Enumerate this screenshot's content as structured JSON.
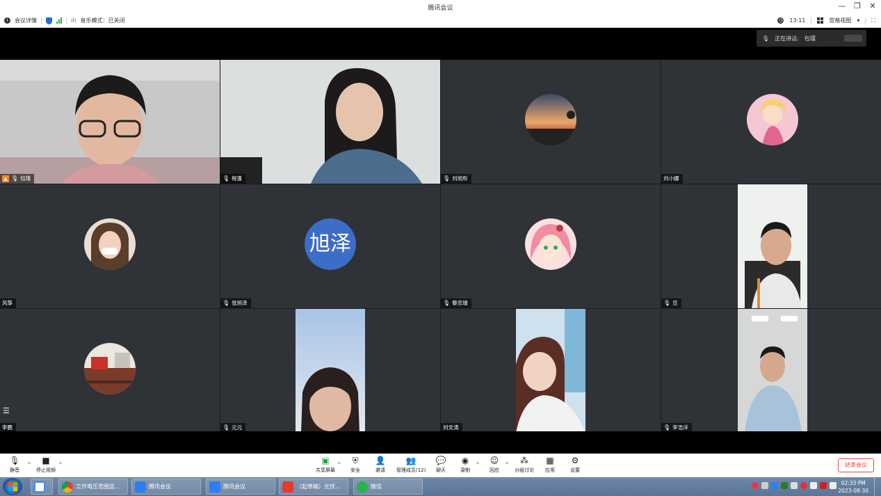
{
  "window": {
    "title": "腾讯会议",
    "minimize": "—",
    "restore": "❐",
    "close": "✕"
  },
  "infobar": {
    "meeting_info": "会议详情",
    "music_mode": "音乐模式：已关闭",
    "time": "13:11",
    "view_mode": "宫格视图"
  },
  "speaking": {
    "label": "正在讲话:",
    "name": "包瑾"
  },
  "participants": [
    {
      "name": "包瑾",
      "host": true,
      "active": true,
      "mic": "muted-off"
    },
    {
      "name": "程蓬"
    },
    {
      "name": "刘旭彤"
    },
    {
      "name": "刘小娜"
    },
    {
      "name": "风筝"
    },
    {
      "name": "张旭泽",
      "avatar_text": "旭泽"
    },
    {
      "name": "黎忠瑞"
    },
    {
      "name": "豆"
    },
    {
      "name": "李鹏"
    },
    {
      "name": "元元"
    },
    {
      "name": "刘文涛"
    },
    {
      "name": "李浩洋"
    }
  ],
  "toolbar": {
    "mute": "静音",
    "stop_video": "停止视频",
    "share_screen": "共享屏幕",
    "security": "安全",
    "invite": "邀请",
    "manage_members": "管理成员(12)",
    "chat": "聊天",
    "record": "录制",
    "reactions": "回应",
    "breakout": "分组讨论",
    "apps": "应用",
    "settings": "设置",
    "end_meeting": "结束会议"
  },
  "taskbar": {
    "items": [
      "工作电压范围显...",
      "腾讯会议",
      "腾讯会议",
      "（起草稿）光伏...",
      "微信"
    ],
    "time": "02:33 PM",
    "date": "2023-08-30"
  },
  "colors": {
    "active_speaker": "#20c05c",
    "end_button": "#ee4444",
    "avatar_blue": "#3d6ec7",
    "shield": "#1e6de8"
  }
}
